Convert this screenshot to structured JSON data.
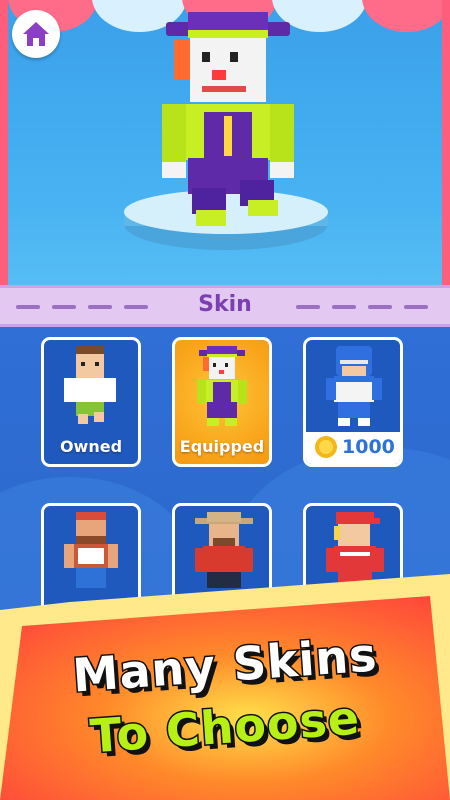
{
  "nav": {
    "home_icon": "home-icon"
  },
  "section": {
    "title": "Skin"
  },
  "skins": [
    {
      "status": "Owned",
      "type": "owned"
    },
    {
      "status": "Equipped",
      "type": "equipped"
    },
    {
      "price": "1000",
      "type": "price",
      "currency_icon": "coin-icon"
    },
    {
      "type": "locked"
    },
    {
      "type": "locked"
    },
    {
      "type": "locked"
    }
  ],
  "promo": {
    "line1": "Many Skins",
    "line2": "To Choose"
  },
  "colors": {
    "accent_purple": "#7a3fb0",
    "equipped_gold": "#f8a419",
    "price_blue": "#2e72d8",
    "promo_green": "#b6f015"
  }
}
